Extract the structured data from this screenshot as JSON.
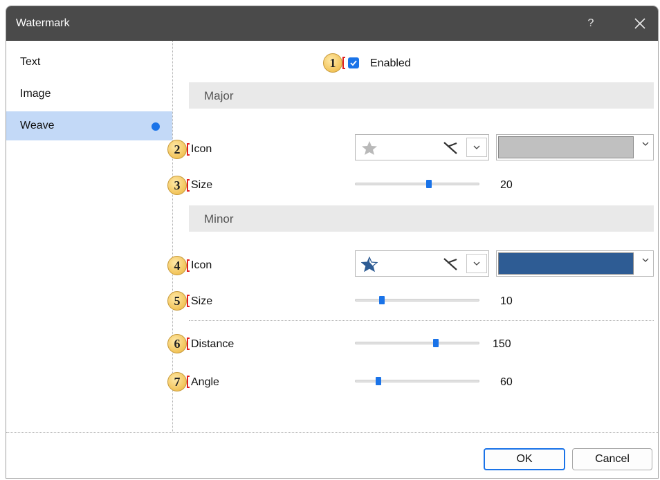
{
  "window": {
    "title": "Watermark",
    "help": "?"
  },
  "nav": {
    "items": [
      {
        "label": "Text"
      },
      {
        "label": "Image"
      },
      {
        "label": "Weave"
      }
    ]
  },
  "enabled": {
    "badge": "1",
    "label": "Enabled",
    "checked": true
  },
  "major": {
    "header": "Major",
    "icon": {
      "badge": "2",
      "label": "Icon",
      "glyph": "star-icon",
      "color": "#c0c0c0"
    },
    "size": {
      "badge": "3",
      "label": "Size",
      "value": "20",
      "level": 0.6
    }
  },
  "minor": {
    "header": "Minor",
    "icon": {
      "badge": "4",
      "label": "Icon",
      "glyph": "half-star-icon",
      "color": "#2e5c94"
    },
    "size": {
      "badge": "5",
      "label": "Size",
      "value": "10",
      "level": 0.2
    }
  },
  "distance": {
    "badge": "6",
    "label": "Distance",
    "value": "150",
    "level": 0.66
  },
  "angle": {
    "badge": "7",
    "label": "Angle",
    "value": "60",
    "level": 0.17
  },
  "footer": {
    "ok": "OK",
    "cancel": "Cancel"
  },
  "colors": {
    "accent": "#1a73e8",
    "selected_nav": "#c3d9f7",
    "titlebar": "#4a4a4a"
  }
}
